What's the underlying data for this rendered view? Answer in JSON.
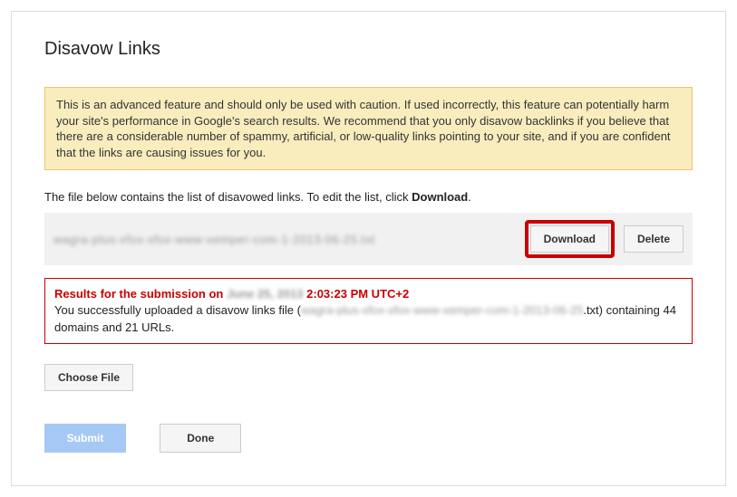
{
  "page": {
    "title": "Disavow Links"
  },
  "warning": {
    "text": "This is an advanced feature and should only be used with caution. If used incorrectly, this feature can potentially harm your site's performance in Google's search results. We recommend that you only disavow backlinks if you believe that there are a considerable number of spammy, artificial, or low-quality links pointing to your site, and if you are confident that the links are causing issues for you."
  },
  "instruction": {
    "prefix": "The file below contains the list of disavowed links. To edit the list, click ",
    "action_word": "Download",
    "suffix": "."
  },
  "file_row": {
    "filename_obscured": "wagra-plus-xfox-xfox-www-xemper-com-1-2013-06-25.txt",
    "download_label": "Download",
    "delete_label": "Delete"
  },
  "results": {
    "title_prefix": "Results for the submission on ",
    "title_date_obscured": "June 25, 2013",
    "title_time": " 2:03:23 PM UTC+2",
    "body_prefix": "You successfully uploaded a disavow links file (",
    "body_filename_obscured": "wagra-plus-xfox-xfox-www-xemper-com-1-2013-06-25",
    "body_suffix": ".txt) containing 44 domains and 21 URLs."
  },
  "choose": {
    "label": "Choose File"
  },
  "actions": {
    "submit_label": "Submit",
    "done_label": "Done"
  }
}
